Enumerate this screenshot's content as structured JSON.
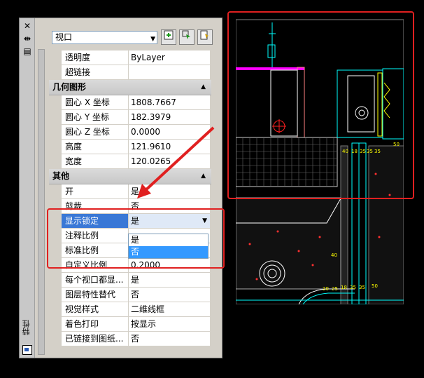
{
  "palette": {
    "vertical_title": "特性",
    "close_label": "✕",
    "autohide_label": "⇹",
    "menu_label": "▤"
  },
  "toolbar": {
    "object_type": "视口",
    "btn_quickselect_icon": "quick-select-icon",
    "btn_select_icon": "select-objects-icon",
    "btn_pickadd_icon": "toggle-pickadd-icon"
  },
  "general_rows": [
    {
      "label": "透明度",
      "value": "ByLayer"
    },
    {
      "label": "超链接",
      "value": ""
    }
  ],
  "geometry": {
    "title": "几何图形",
    "rows": [
      {
        "label": "圆心 X 坐标",
        "value": "1808.7667"
      },
      {
        "label": "圆心 Y 坐标",
        "value": "182.3979"
      },
      {
        "label": "圆心 Z 坐标",
        "value": "0.0000"
      },
      {
        "label": "高度",
        "value": "121.9610"
      },
      {
        "label": "宽度",
        "value": "120.0265"
      }
    ]
  },
  "misc": {
    "title": "其他",
    "rows": [
      {
        "label": "开",
        "value": "是"
      },
      {
        "label": "剪裁",
        "value": "否"
      },
      {
        "label": "显示锁定",
        "value": "是"
      },
      {
        "label": "注释比例",
        "value": ""
      },
      {
        "label": "标准比例",
        "value": ""
      },
      {
        "label": "自定义比例",
        "value": "0.2000"
      },
      {
        "label": "每个视口都显...",
        "value": "是"
      },
      {
        "label": "图层特性替代",
        "value": "否"
      },
      {
        "label": "视觉样式",
        "value": "二维线框"
      },
      {
        "label": "着色打印",
        "value": "按显示"
      },
      {
        "label": "已链接到图纸...",
        "value": "否"
      }
    ]
  },
  "dropdown": {
    "options": [
      "是",
      "否"
    ],
    "selected": "否"
  },
  "colors": {
    "highlight": "#e02020",
    "selection": "#3a78d6",
    "cad_cyan": "#00ffff",
    "cad_magenta": "#ff00ff",
    "cad_yellow": "#ffff00"
  },
  "cad_dims": [
    "40",
    "18",
    "35",
    "35",
    "50",
    "35",
    "40",
    "20",
    "25",
    "18",
    "35",
    "35",
    "50"
  ]
}
